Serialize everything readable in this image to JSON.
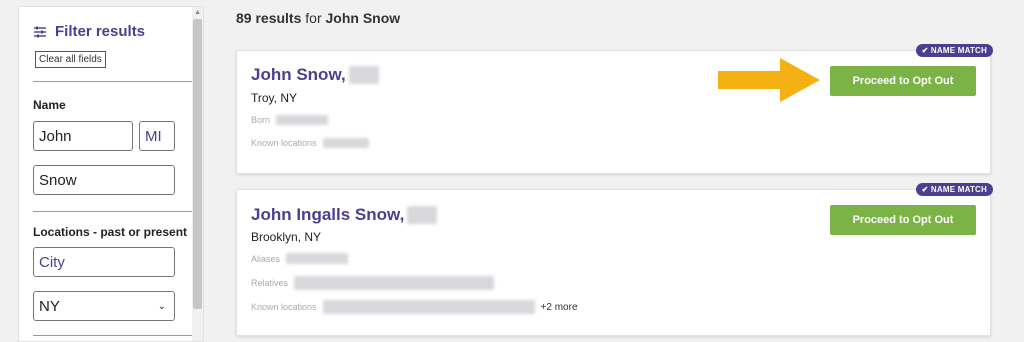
{
  "sidebar": {
    "title": "Filter results",
    "clear_label": "Clear all fields",
    "name_label": "Name",
    "first_name": "John",
    "middle_initial_placeholder": "MI",
    "last_name": "Snow",
    "locations_label": "Locations - past or present",
    "city_placeholder": "City",
    "state_value": "NY"
  },
  "results": {
    "count": "89 results",
    "for_text": "for",
    "query": "John Snow"
  },
  "cards": [
    {
      "name": "John Snow,",
      "location": "Troy, NY",
      "badge": "NAME MATCH",
      "button": "Proceed to Opt Out",
      "fields": [
        {
          "label": "Born"
        },
        {
          "label": "Known locations"
        }
      ]
    },
    {
      "name": "John Ingalls Snow,",
      "location": "Brooklyn, NY",
      "badge": "NAME MATCH",
      "button": "Proceed to Opt Out",
      "fields": [
        {
          "label": "Aliases"
        },
        {
          "label": "Relatives"
        },
        {
          "label": "Known locations",
          "extra": "+2 more"
        }
      ]
    }
  ],
  "colors": {
    "brand_purple": "#4b3f8f",
    "button_green": "#7cb347",
    "arrow_orange": "#f5b014"
  },
  "icons": {
    "filter": "sliders-icon",
    "badge_check": "check-icon",
    "select_arrow": "chevron-down-icon",
    "annotation": "arrow-right-icon"
  }
}
